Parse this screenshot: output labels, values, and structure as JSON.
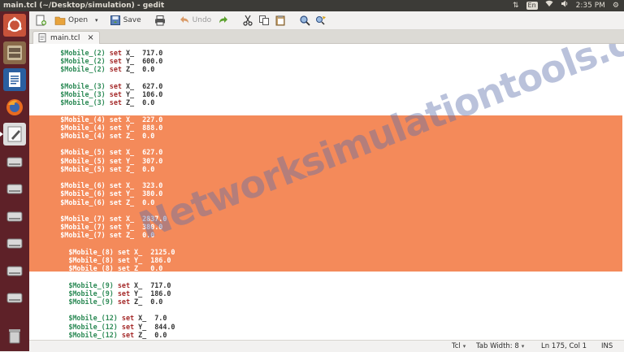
{
  "window": {
    "title": "main.tcl (~/Desktop/simulation) - gedit"
  },
  "tray": {
    "updown": "⇅",
    "keyboard": "En",
    "wifi": "◔",
    "volume": "🔈",
    "clock": "2:35 PM",
    "gear": "⚙"
  },
  "launcher": [
    "ubuntu-dash",
    "files",
    "libreoffice-writer",
    "firefox",
    "text-editor",
    "drive-1",
    "drive-2",
    "drive-3",
    "drive-4",
    "drive-5",
    "drive-6",
    "drive-7",
    "trash"
  ],
  "toolbar": {
    "new_label": "",
    "open_label": "Open",
    "save_label": "Save",
    "undo_label": "Undo"
  },
  "tab": {
    "label": "main.tcl",
    "close": "×"
  },
  "editor": {
    "lines": [
      {
        "indent": "      ",
        "var": "$Mobile_(2)",
        "kw": "set",
        "rest": " X_  717.0",
        "sel": false
      },
      {
        "indent": "      ",
        "var": "$Mobile_(2)",
        "kw": "set",
        "rest": " Y_  600.0",
        "sel": false
      },
      {
        "indent": "      ",
        "var": "$Mobile_(2)",
        "kw": "set",
        "rest": " Z_  0.0",
        "sel": false
      },
      {
        "blank": true
      },
      {
        "indent": "      ",
        "var": "$Mobile_(3)",
        "kw": "set",
        "rest": " X_  627.0",
        "sel": false
      },
      {
        "indent": "      ",
        "var": "$Mobile_(3)",
        "kw": "set",
        "rest": " Y_  106.0",
        "sel": false
      },
      {
        "indent": "      ",
        "var": "$Mobile_(3)",
        "kw": "set",
        "rest": " Z_  0.0",
        "sel": false
      },
      {
        "blank": true
      },
      {
        "indent": "      ",
        "var": "$Mobile_(4)",
        "kw": "set",
        "rest": " X_  227.0",
        "sel": true
      },
      {
        "indent": "      ",
        "var": "$Mobile_(4)",
        "kw": "set",
        "rest": " Y_  888.0",
        "sel": true
      },
      {
        "indent": "      ",
        "var": "$Mobile_(4)",
        "kw": "set",
        "rest": " Z_  0.0",
        "sel": true
      },
      {
        "blank": true
      },
      {
        "indent": "      ",
        "var": "$Mobile_(5)",
        "kw": "set",
        "rest": " X_  627.0",
        "sel": true
      },
      {
        "indent": "      ",
        "var": "$Mobile_(5)",
        "kw": "set",
        "rest": " Y_  307.0",
        "sel": true
      },
      {
        "indent": "      ",
        "var": "$Mobile_(5)",
        "kw": "set",
        "rest": " Z_  0.0",
        "sel": true
      },
      {
        "blank": true
      },
      {
        "indent": "      ",
        "var": "$Mobile_(6)",
        "kw": "set",
        "rest": " X_  323.0",
        "sel": true
      },
      {
        "indent": "      ",
        "var": "$Mobile_(6)",
        "kw": "set",
        "rest": " Y_  380.0",
        "sel": true
      },
      {
        "indent": "      ",
        "var": "$Mobile_(6)",
        "kw": "set",
        "rest": " Z_  0.0",
        "sel": true
      },
      {
        "blank": true
      },
      {
        "indent": "      ",
        "var": "$Mobile_(7)",
        "kw": "set",
        "rest": " X_  2837.0",
        "sel": true
      },
      {
        "indent": "      ",
        "var": "$Mobile_(7)",
        "kw": "set",
        "rest": " Y_  380.0",
        "sel": true
      },
      {
        "indent": "      ",
        "var": "$Mobile_(7)",
        "kw": "set",
        "rest": " Z_  0.0",
        "sel": true
      },
      {
        "blank": true
      },
      {
        "indent": "        ",
        "var": "$Mobile_(8)",
        "kw": "set",
        "rest": " X_  2125.0",
        "sel": true
      },
      {
        "indent": "        ",
        "var": "$Mobile_(8)",
        "kw": "set",
        "rest": " Y_  186.0",
        "sel": true
      },
      {
        "indent": "        ",
        "var": "$Mobile_(8)",
        "kw": "set",
        "rest": " Z_  0.0",
        "sel": true
      },
      {
        "blank": true
      },
      {
        "indent": "        ",
        "var": "$Mobile_(9)",
        "kw": "set",
        "rest": " X_  717.0",
        "sel": false
      },
      {
        "indent": "        ",
        "var": "$Mobile_(9)",
        "kw": "set",
        "rest": " Y_  186.0",
        "sel": false
      },
      {
        "indent": "        ",
        "var": "$Mobile_(9)",
        "kw": "set",
        "rest": " Z_  0.0",
        "sel": false
      },
      {
        "blank": true
      },
      {
        "indent": "        ",
        "var": "$Mobile_(12)",
        "kw": "set",
        "rest": " X_  7.0",
        "sel": false
      },
      {
        "indent": "        ",
        "var": "$Mobile_(12)",
        "kw": "set",
        "rest": " Y_  844.0",
        "sel": false
      },
      {
        "indent": "        ",
        "var": "$Mobile_(12)",
        "kw": "set",
        "rest": " Z_  0.0",
        "sel": false
      }
    ]
  },
  "watermark": "Networksimulationtools.com",
  "statusbar": {
    "language": "Tcl",
    "tab_width": "Tab Width: 8",
    "position": "Ln 175, Col 1",
    "mode": "INS"
  },
  "colors": {
    "selection": "#f48a5a",
    "launcher": "#5e2128",
    "panel": "#3c3b37",
    "keyword": "#a52a2a",
    "variable": "#2e8b57"
  }
}
